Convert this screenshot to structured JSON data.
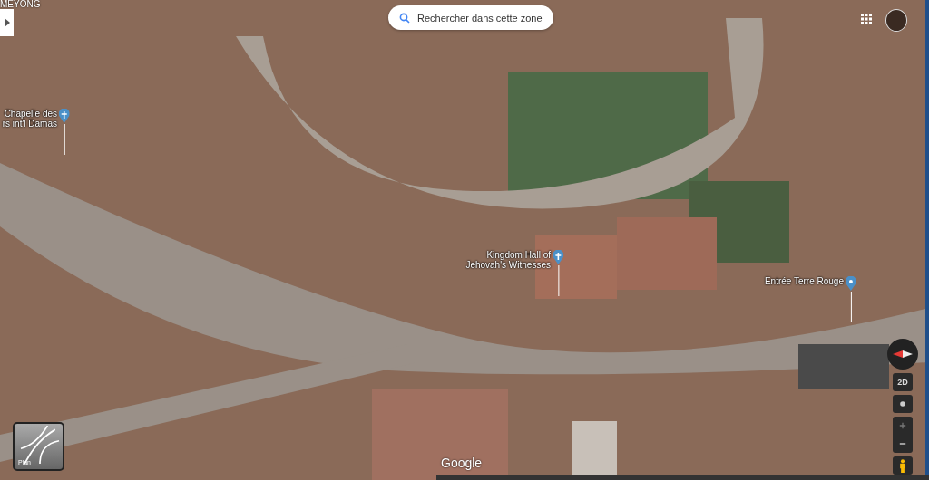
{
  "area_label": "MEYONG",
  "search_area_button": "Rechercher dans cette zone",
  "places": [
    {
      "name": "Chapelle des\nrs int'l Damas",
      "kind": "church"
    },
    {
      "name": "Kingdom Hall of\nJehovah's Witnesses",
      "kind": "church"
    },
    {
      "name": "Entrée Terre Rouge",
      "kind": "pin"
    }
  ],
  "view_toggle": "2D",
  "layer_button": "Plan",
  "logo": "Google"
}
